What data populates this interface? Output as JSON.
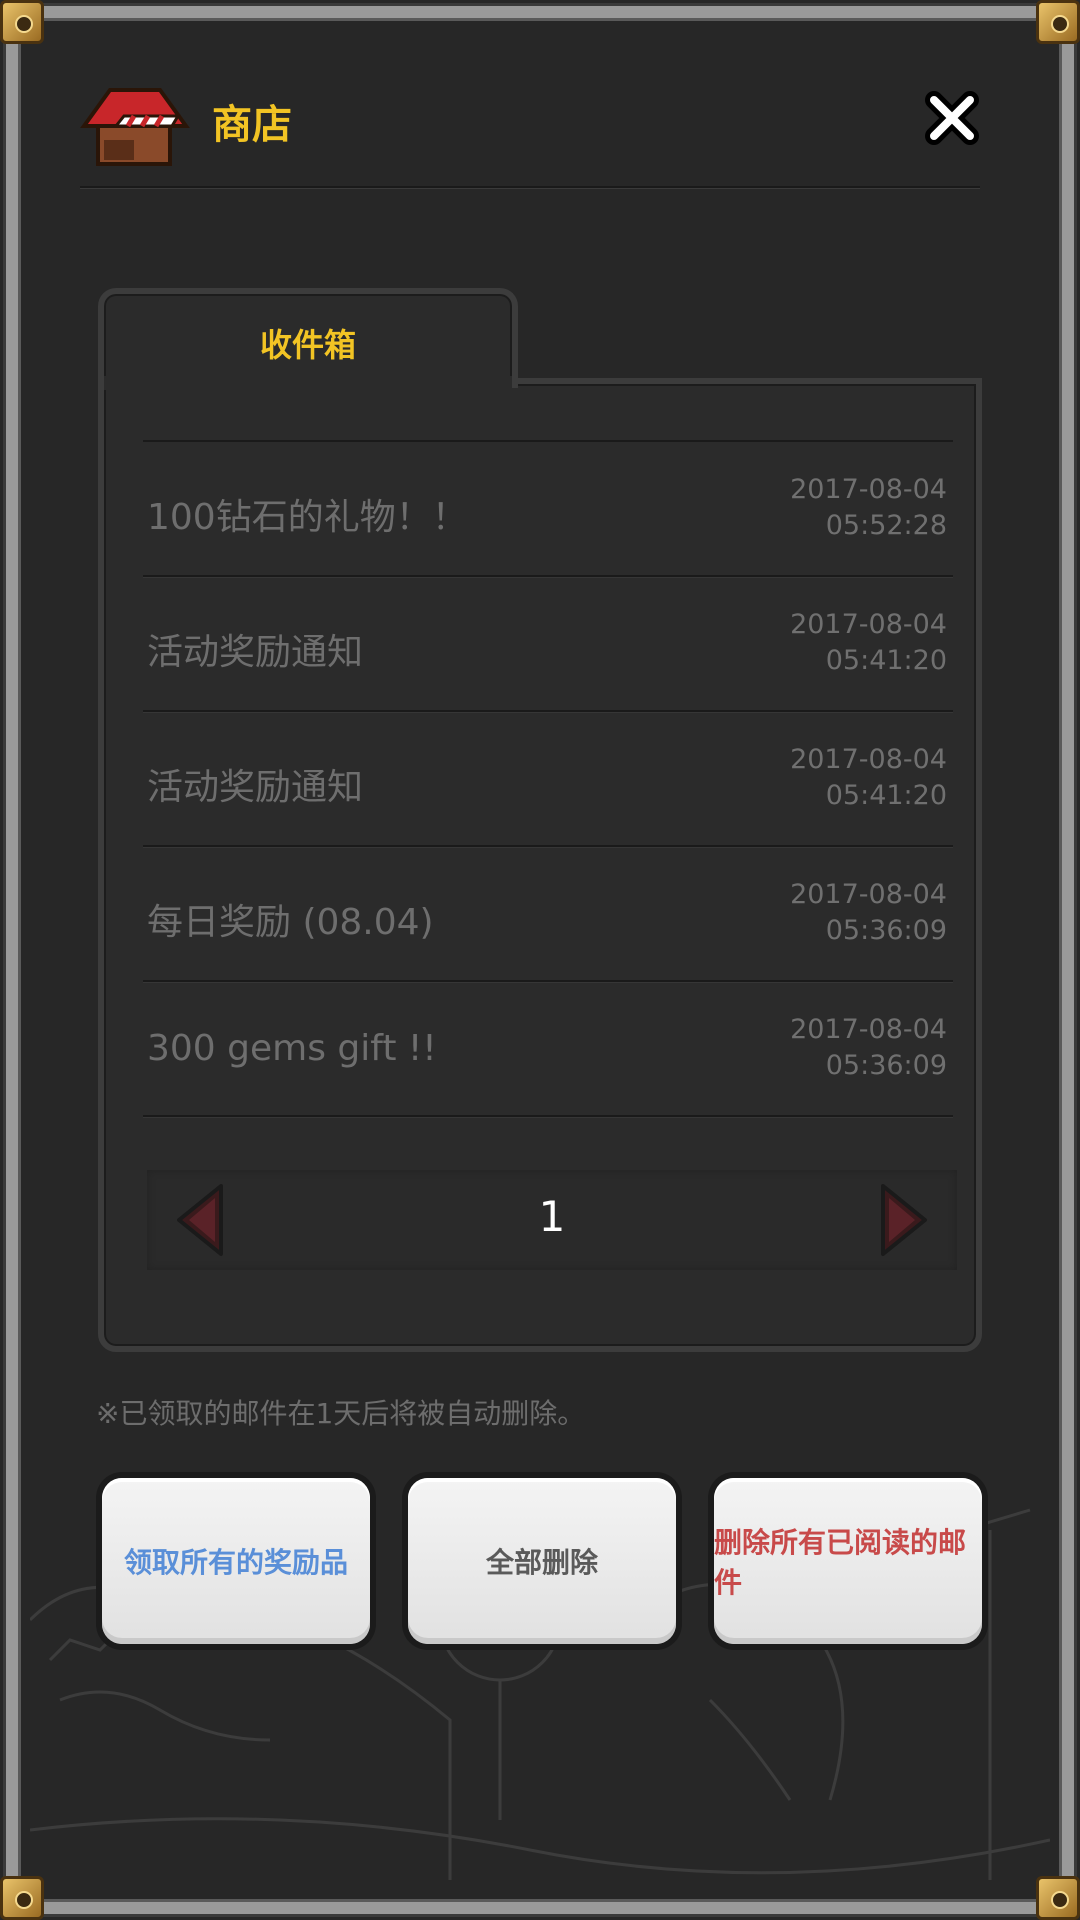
{
  "header": {
    "title": "商店",
    "icon": "shop-icon",
    "close_icon": "close-icon"
  },
  "tab": {
    "label": "收件箱"
  },
  "messages": [
    {
      "title": "100钻石的礼物！！",
      "date": "2017-08-04",
      "time": "05:52:28"
    },
    {
      "title": "活动奖励通知",
      "date": "2017-08-04",
      "time": "05:41:20"
    },
    {
      "title": "活动奖励通知",
      "date": "2017-08-04",
      "time": "05:41:20"
    },
    {
      "title": "每日奖励 (08.04)",
      "date": "2017-08-04",
      "time": "05:36:09"
    },
    {
      "title": "300 gems gift !!",
      "date": "2017-08-04",
      "time": "05:36:09"
    }
  ],
  "pager": {
    "page": "1",
    "prev_icon": "triangle-left-icon",
    "next_icon": "triangle-right-icon"
  },
  "note": "※已领取的邮件在1天后将被自动删除。",
  "buttons": {
    "left": "领取所有的奖励品",
    "center": "全部删除",
    "right": "删除所有已阅读的邮件"
  },
  "colors": {
    "accent_yellow": "#f2c424",
    "button_blue_text": "#5a8fd8",
    "button_red_text": "#c84a4a",
    "frame_gold": "#e9c36a"
  }
}
